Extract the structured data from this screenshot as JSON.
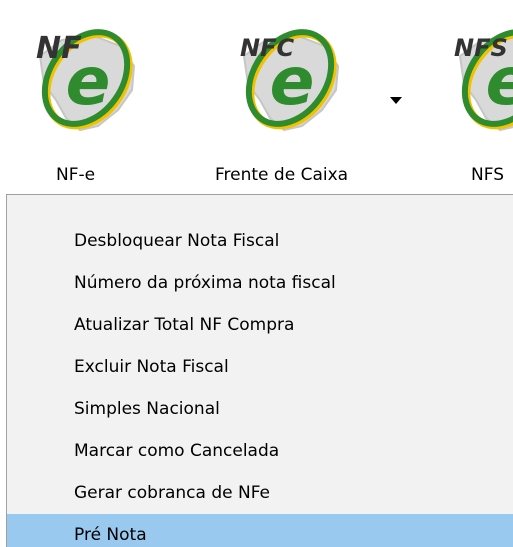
{
  "toolbar": {
    "buttons": [
      {
        "label": "NF-e",
        "logo_text": "NF",
        "has_dropdown": false
      },
      {
        "label": "Frente de Caixa",
        "logo_text": "NFC",
        "has_dropdown": true
      },
      {
        "label": "NFS",
        "logo_text": "NFS",
        "has_dropdown": false
      }
    ]
  },
  "menu": {
    "items": [
      "Desbloquear Nota Fiscal",
      "Número da próxima nota fiscal",
      "Atualizar Total NF Compra",
      "Excluir Nota Fiscal",
      "Simples Nacional",
      "Marcar como Cancelada",
      "Gerar cobranca de NFe",
      "Pré Nota"
    ],
    "selected_index": 7
  },
  "colors": {
    "menu_background": "#f2f2f2",
    "selection_highlight": "#99c9ef",
    "logo_green": "#2e8b2e",
    "logo_yellow": "#f2c200"
  },
  "icons": [
    "nfe-logo-icon",
    "nfc-logo-icon",
    "nfs-logo-icon",
    "chevron-down-icon"
  ]
}
